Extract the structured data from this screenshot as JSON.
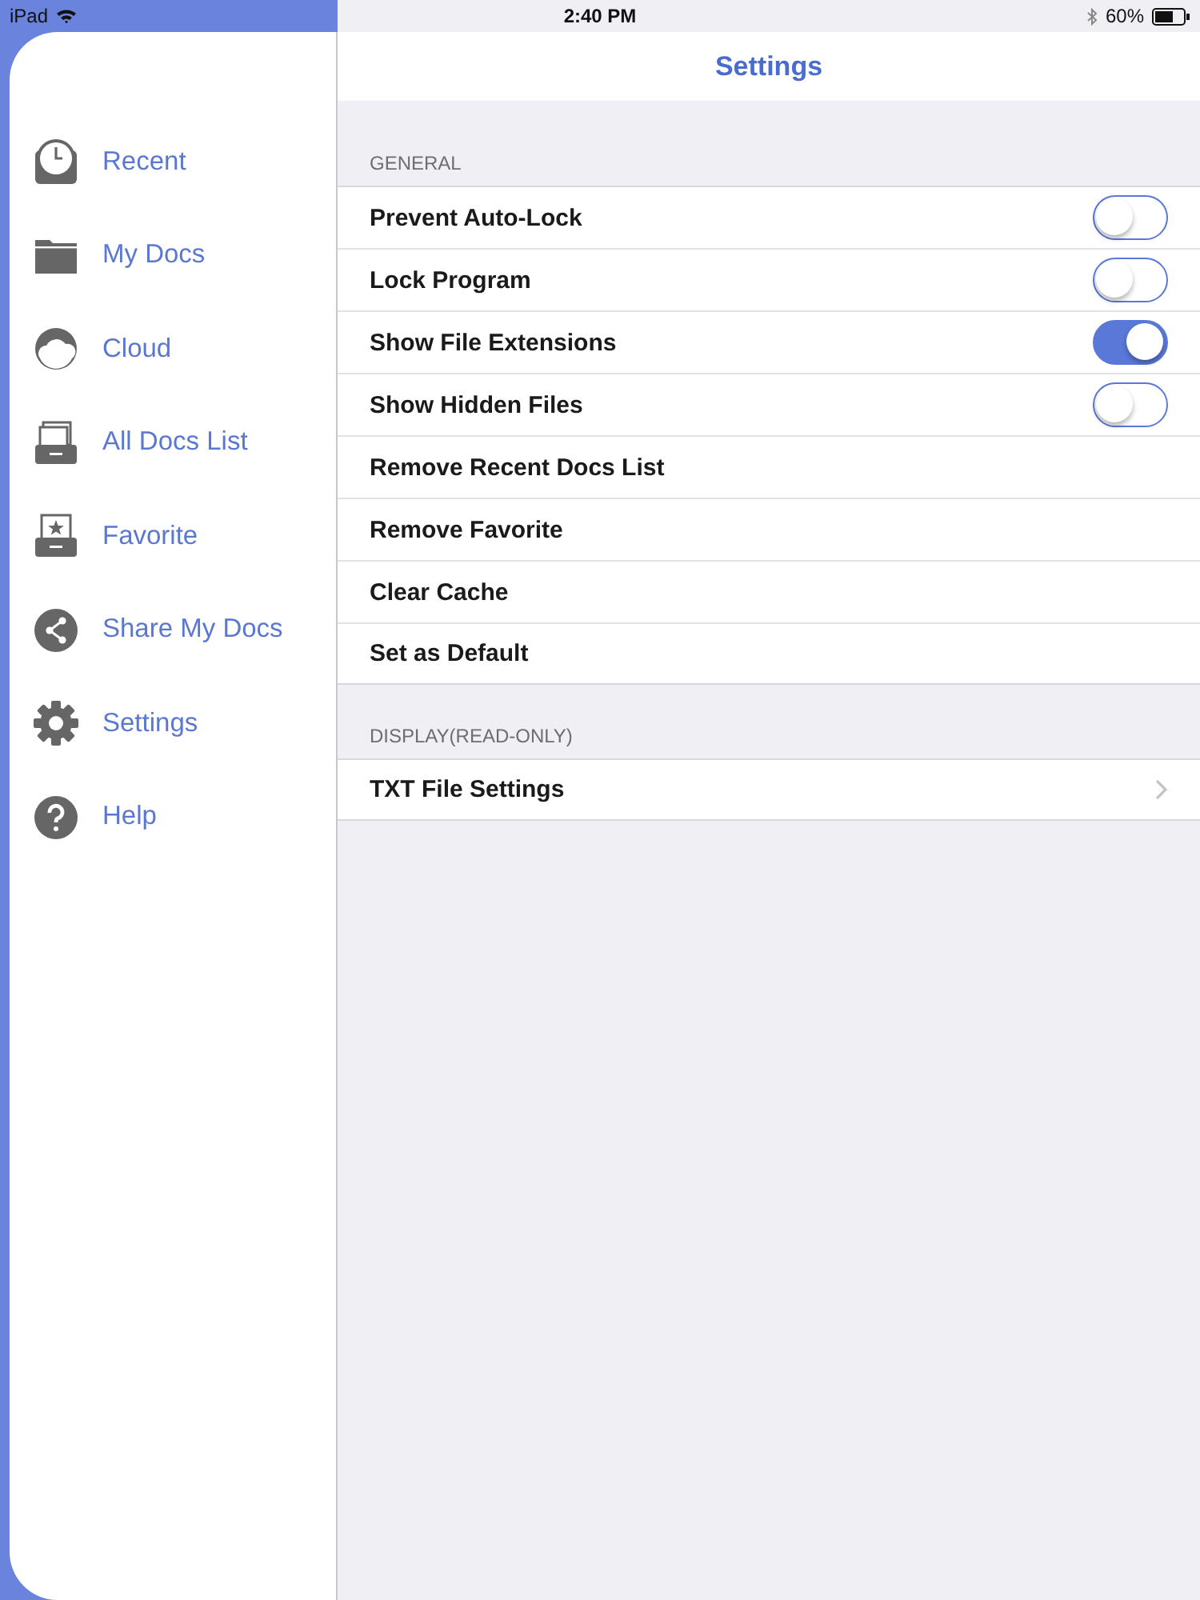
{
  "status_bar": {
    "device": "iPad",
    "time": "2:40 PM",
    "battery": "60%"
  },
  "sidebar": {
    "items": [
      {
        "label": "Recent"
      },
      {
        "label": "My Docs"
      },
      {
        "label": "Cloud"
      },
      {
        "label": "All Docs List"
      },
      {
        "label": "Favorite"
      },
      {
        "label": "Share My Docs"
      },
      {
        "label": "Settings"
      },
      {
        "label": "Help"
      }
    ]
  },
  "nav_bar": {
    "title": "Settings"
  },
  "sections": [
    {
      "header": "GENERAL",
      "rows": [
        {
          "label": "Prevent Auto-Lock",
          "kind": "toggle",
          "on": false
        },
        {
          "label": "Lock Program",
          "kind": "toggle",
          "on": false
        },
        {
          "label": "Show File Extensions",
          "kind": "toggle",
          "on": true
        },
        {
          "label": "Show Hidden Files",
          "kind": "toggle",
          "on": false
        },
        {
          "label": "Remove Recent Docs List",
          "kind": "action"
        },
        {
          "label": "Remove Favorite",
          "kind": "action"
        },
        {
          "label": "Clear Cache",
          "kind": "action"
        },
        {
          "label": "Set as Default",
          "kind": "action"
        }
      ]
    },
    {
      "header": "DISPLAY(READ-ONLY)",
      "rows": [
        {
          "label": "TXT File Settings",
          "kind": "disclosure"
        }
      ]
    }
  ]
}
